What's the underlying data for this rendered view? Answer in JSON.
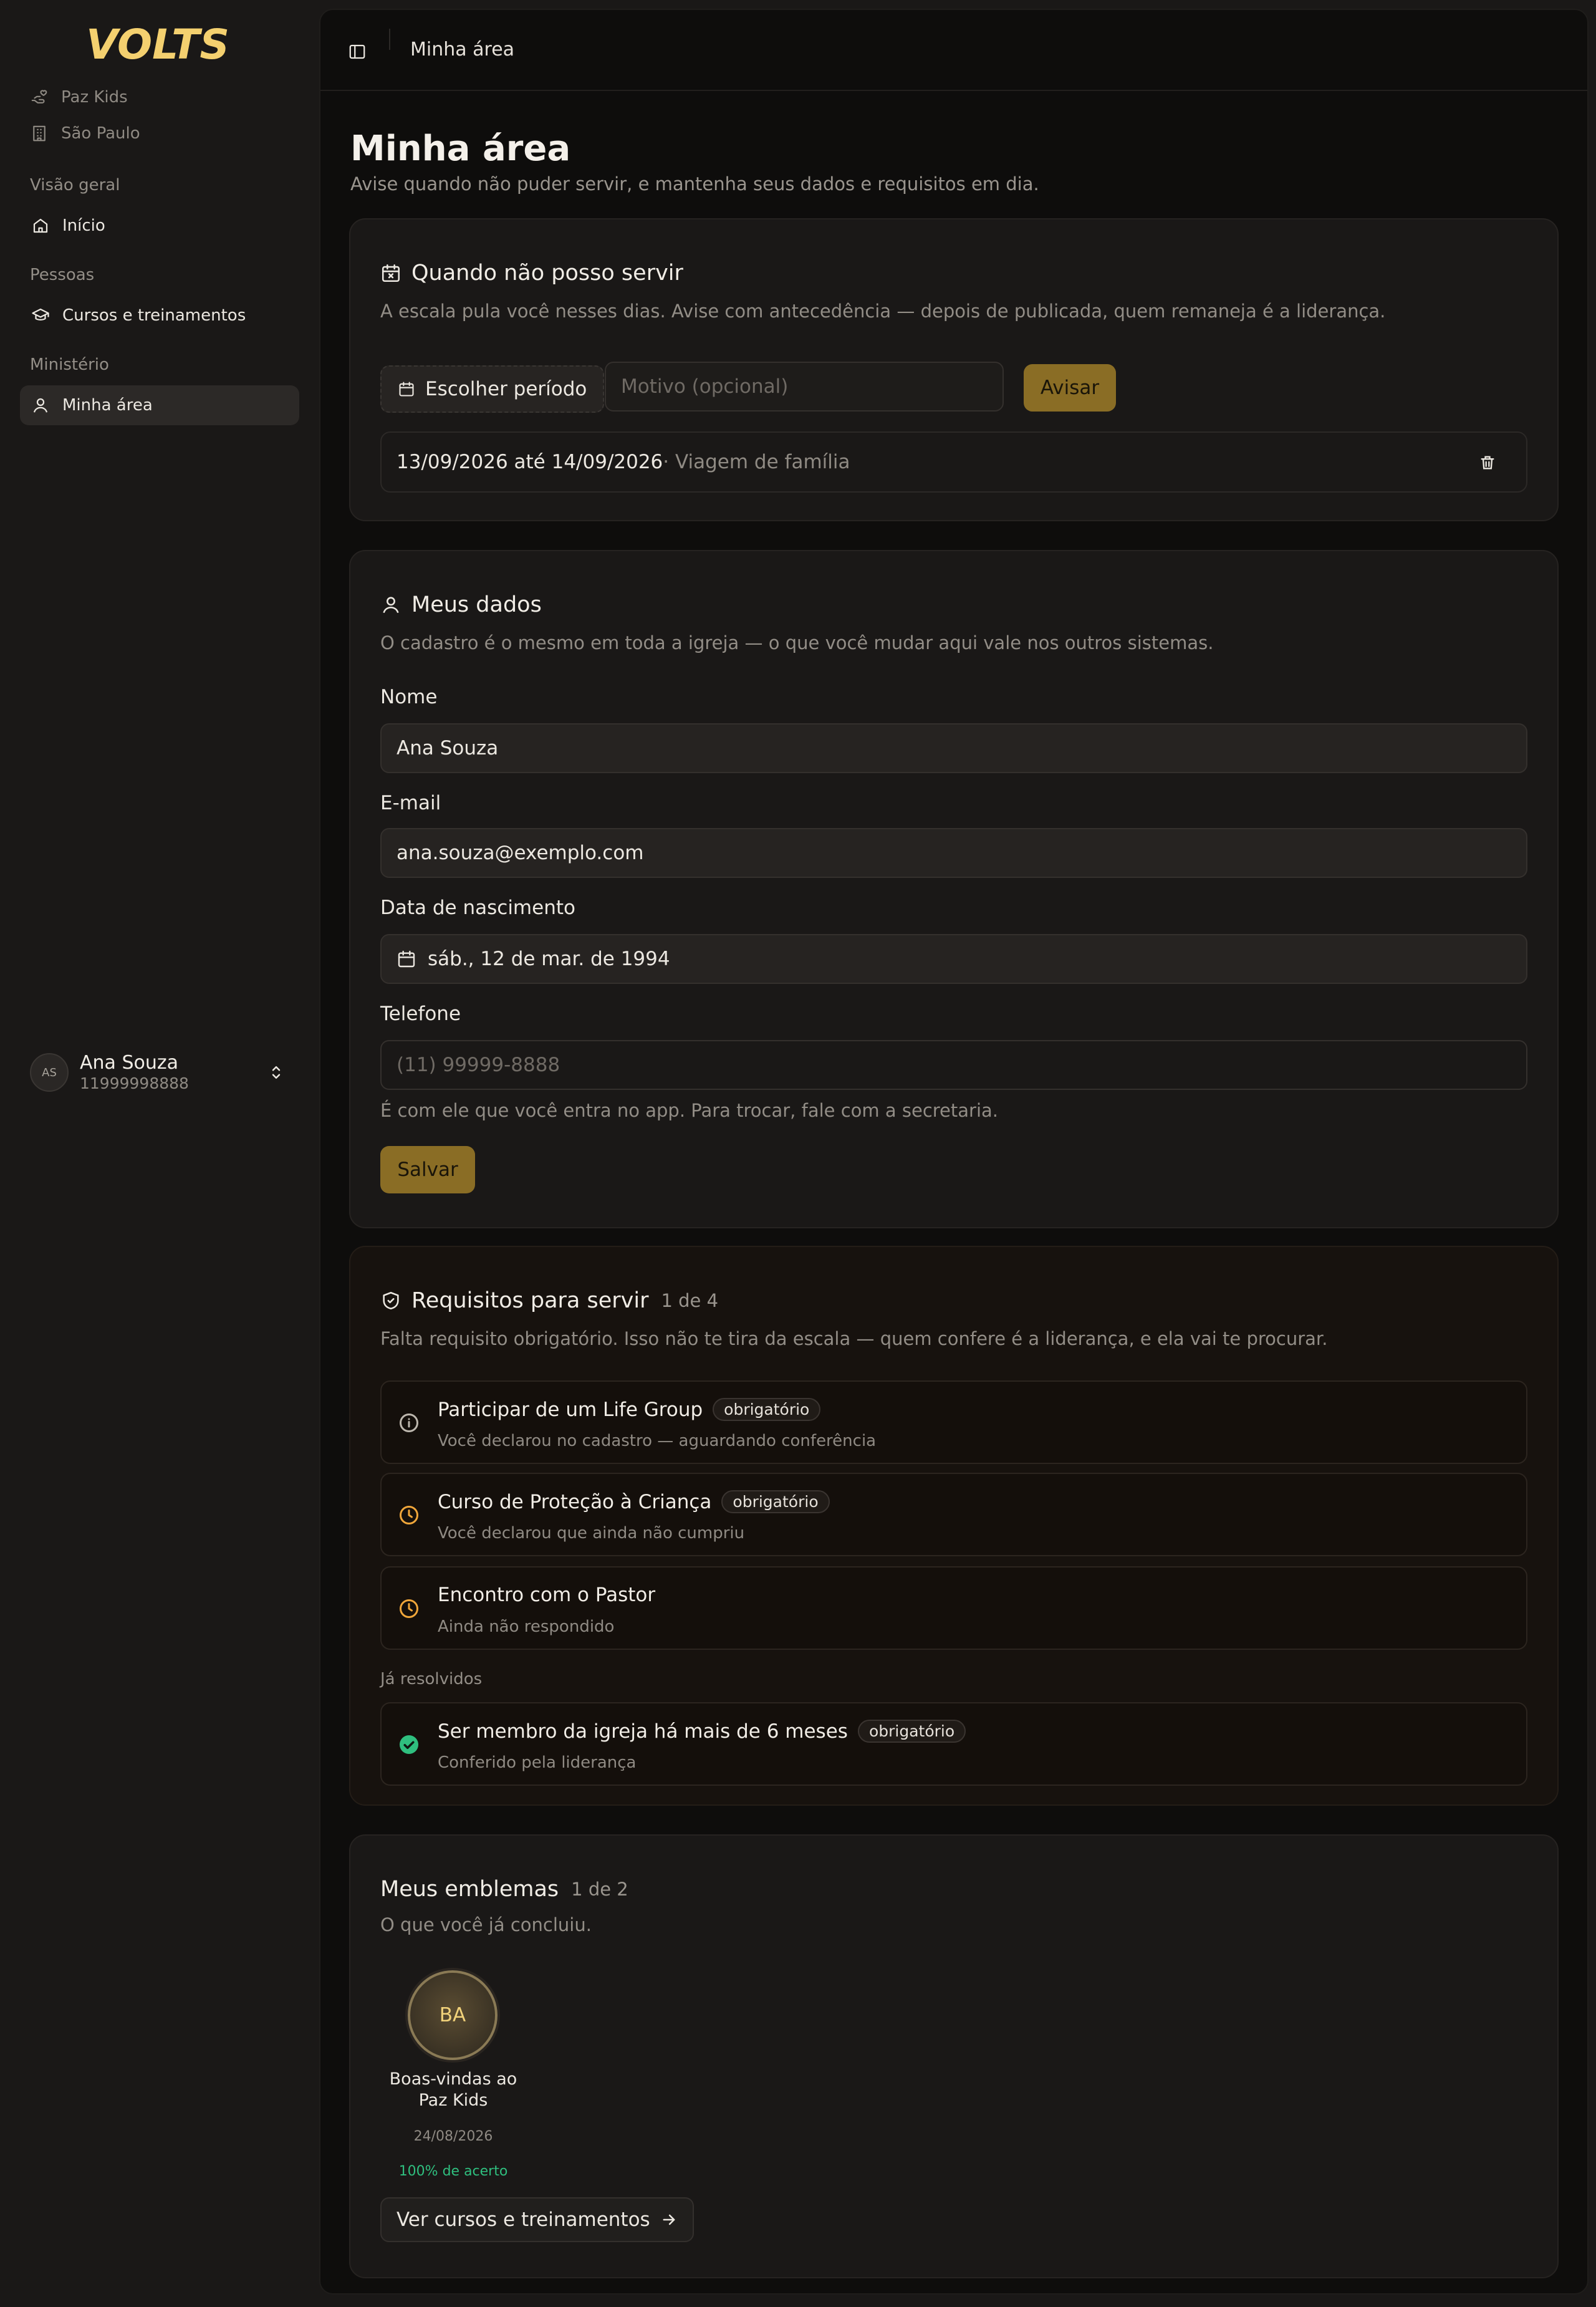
{
  "app": {
    "logo_text": "VOLTS",
    "accent": "#f4d06f",
    "gold_button": "#8a6d25"
  },
  "sidebar": {
    "context": [
      {
        "label": "Paz Kids",
        "icon": "hand-heart-icon"
      },
      {
        "label": "São Paulo",
        "icon": "building-icon"
      }
    ],
    "sections": [
      {
        "label": "Visão geral",
        "items": [
          {
            "label": "Início",
            "icon": "home-icon",
            "active": false
          }
        ]
      },
      {
        "label": "Pessoas",
        "items": [
          {
            "label": "Cursos e treinamentos",
            "icon": "graduation-cap-icon",
            "active": false
          }
        ]
      },
      {
        "label": "Ministério",
        "items": [
          {
            "label": "Minha área",
            "icon": "user-icon",
            "active": true
          }
        ]
      }
    ],
    "user": {
      "initials": "AS",
      "name": "Ana Souza",
      "phone": "11999998888"
    }
  },
  "topbar": {
    "breadcrumb": "Minha área"
  },
  "page": {
    "title": "Minha área",
    "subtitle": "Avise quando não puder servir, e mantenha seus dados e requisitos em dia."
  },
  "unavailable": {
    "title": "Quando não posso servir",
    "description": "A escala pula você nesses dias. Avise com antecedência — depois de publicada, quem remaneja é a liderança.",
    "period_button": "Escolher período",
    "reason_placeholder": "Motivo (opcional)",
    "notify_button": "Avisar",
    "entries": [
      {
        "dates": "13/09/2026 até 14/09/2026",
        "reason": " · Viagem de família"
      }
    ]
  },
  "profile": {
    "title": "Meus dados",
    "description": "O cadastro é o mesmo em toda a igreja — o que você mudar aqui vale nos outros sistemas.",
    "name_label": "Nome",
    "name_value": "Ana Souza",
    "email_label": "E-mail",
    "email_value": "ana.souza@exemplo.com",
    "birth_label": "Data de nascimento",
    "birth_value": "sáb., 12 de mar. de 1994",
    "phone_label": "Telefone",
    "phone_placeholder": "(11) 99999-8888",
    "phone_hint": "É com ele que você entra no app. Para trocar, fale com a secretaria.",
    "save_button": "Salvar"
  },
  "requirements": {
    "title": "Requisitos para servir",
    "count": "1 de 4",
    "description": "Falta requisito obrigatório. Isso não te tira da escala — quem confere é a liderança, e ela vai te procurar.",
    "pending": [
      {
        "title": "Participar de um Life Group",
        "badge": "obrigatório",
        "sub": "Você declarou no cadastro — aguardando conferência",
        "icon": "info-icon",
        "color": "#bdb7ae"
      },
      {
        "title": "Curso de Proteção à Criança",
        "badge": "obrigatório",
        "sub": "Você declarou que ainda não cumpriu",
        "icon": "clock-icon",
        "color": "#f0a63a"
      },
      {
        "title": "Encontro com o Pastor",
        "badge": "",
        "sub": "Ainda não respondido",
        "icon": "clock-icon",
        "color": "#f0a63a"
      }
    ],
    "resolved_label": "Já resolvidos",
    "resolved": [
      {
        "title": "Ser membro da igreja há mais de 6 meses",
        "badge": "obrigatório",
        "sub": "Conferido pela liderança",
        "icon": "check-circle-icon",
        "color": "#2fbf7f"
      }
    ]
  },
  "emblems": {
    "title": "Meus emblemas",
    "count": "1 de 2",
    "description": "O que você já concluiu.",
    "items": [
      {
        "initials": "BA",
        "name": "Boas-vindas ao Paz Kids",
        "date": "24/08/2026",
        "score": "100% de acerto"
      }
    ],
    "courses_button": "Ver cursos e treinamentos"
  }
}
